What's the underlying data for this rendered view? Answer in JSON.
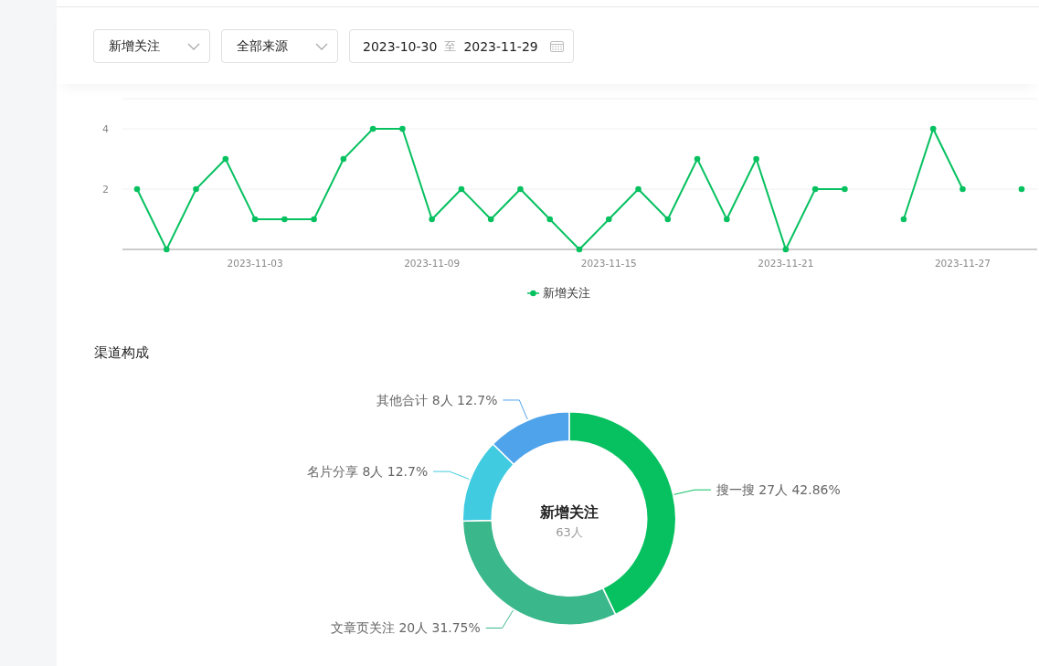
{
  "filters": {
    "metric": {
      "value": "新增关注"
    },
    "source": {
      "value": "全部来源"
    },
    "date_range": {
      "start": "2023-10-30",
      "separator": "至",
      "end": "2023-11-29"
    }
  },
  "trend": {
    "chart_data": {
      "type": "line",
      "categories": [
        null,
        null,
        null,
        null,
        "2023-11-03",
        null,
        null,
        null,
        null,
        null,
        "2023-11-09",
        null,
        null,
        null,
        null,
        null,
        "2023-11-15",
        null,
        null,
        null,
        null,
        null,
        "2023-11-21",
        null,
        null,
        null,
        null,
        null,
        "2023-11-27",
        null,
        null
      ],
      "series": [
        {
          "name": "新增关注",
          "color": "#07c160",
          "marker": "circle",
          "values": [
            2,
            0,
            2,
            3,
            1,
            1,
            1,
            3,
            4,
            4,
            1,
            2,
            1,
            2,
            1,
            0,
            1,
            2,
            1,
            3,
            1,
            3,
            0,
            2,
            2,
            null,
            1,
            4,
            2,
            null,
            2
          ]
        }
      ],
      "ylim": [
        0,
        5
      ],
      "yticks": [
        2,
        4
      ]
    }
  },
  "channels": {
    "title": "渠道构成",
    "chart_data": {
      "type": "donut",
      "categories": [
        "搜一搜",
        "文章页关注",
        "名片分享",
        "其他合计"
      ],
      "values": [
        27,
        20,
        8,
        8
      ],
      "value_labels": [
        "27人 42.86%",
        "20人 31.75%",
        "8人 12.7%",
        "8人 12.7%"
      ]
    },
    "slices": [
      {
        "color": "#07c160"
      },
      {
        "color": "#3ab78b"
      },
      {
        "color": "#40cbe0"
      },
      {
        "color": "#4fa3ea"
      }
    ],
    "center": {
      "title": "新增关注",
      "value": "63人"
    }
  }
}
